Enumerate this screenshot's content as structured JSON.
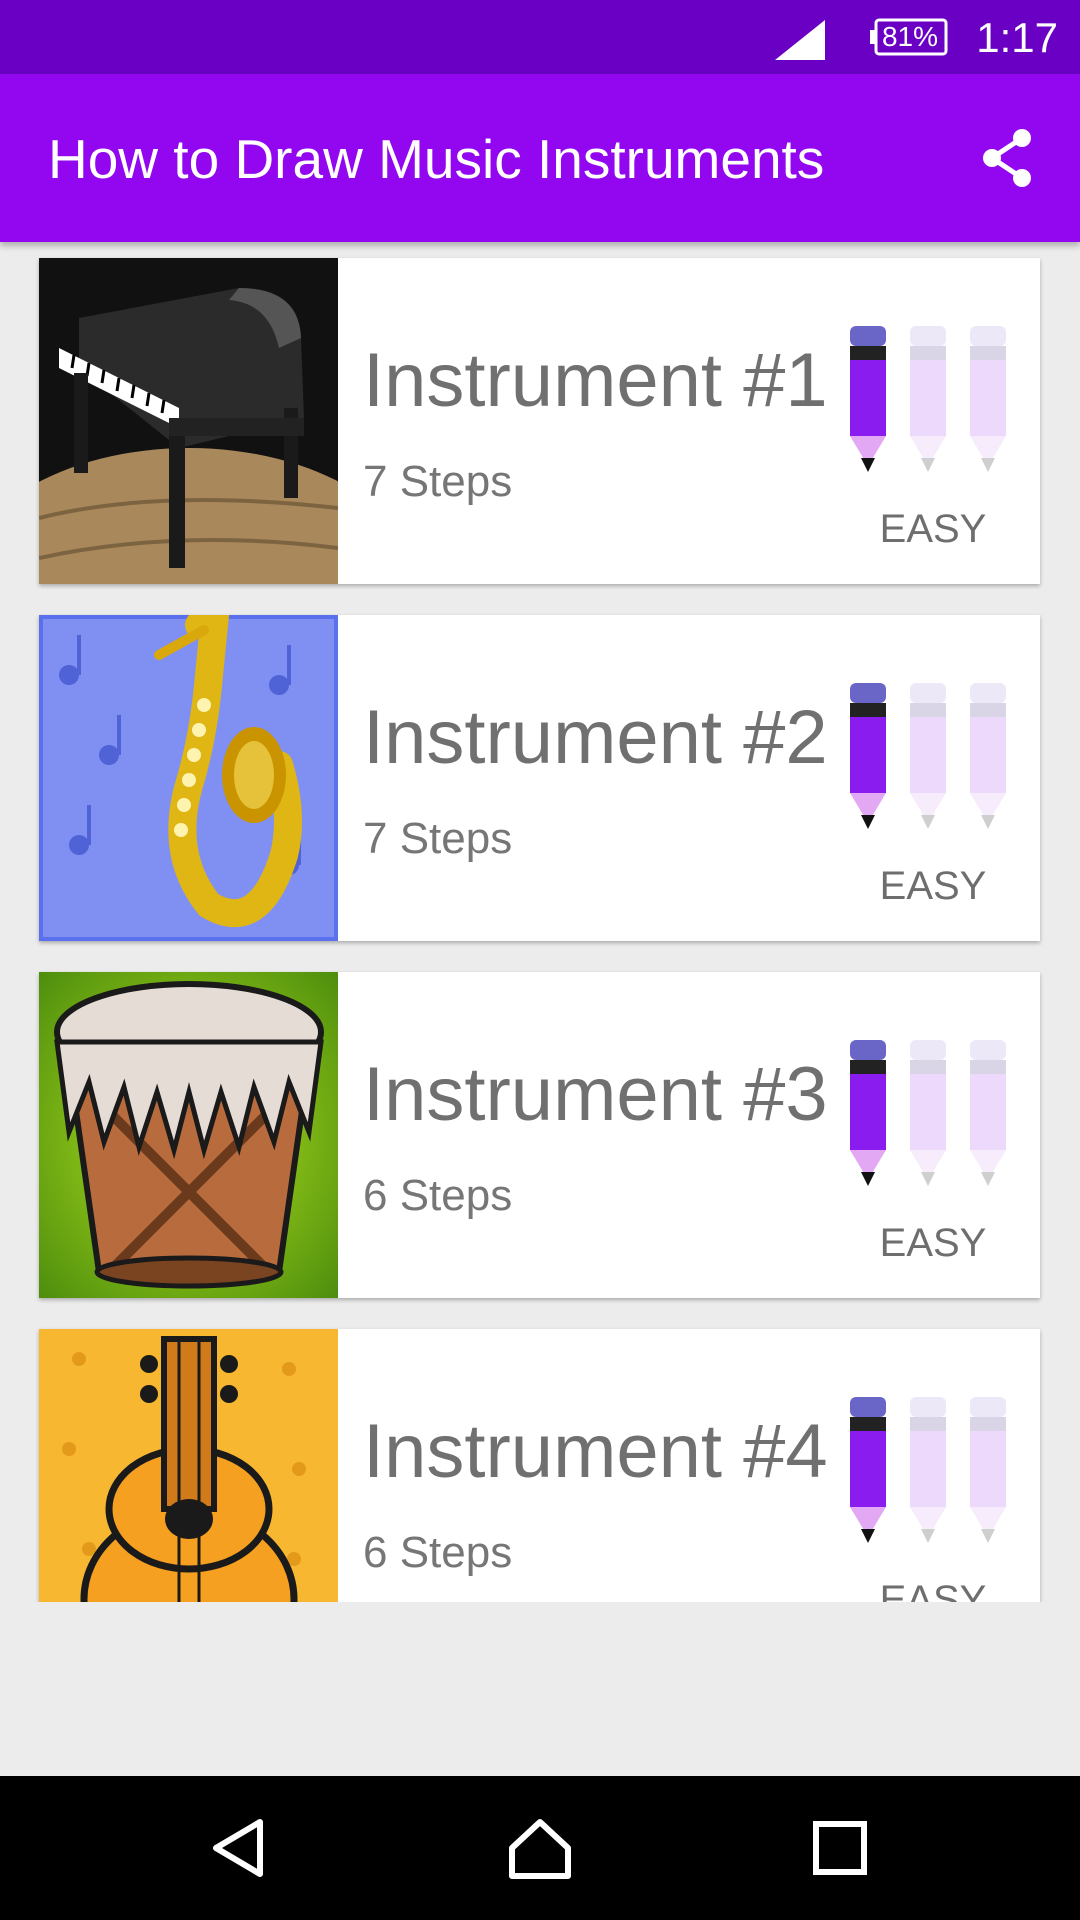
{
  "status_bar": {
    "battery": "81%",
    "time": "1:17",
    "icons": [
      "signal-icon",
      "battery-icon"
    ]
  },
  "app_bar": {
    "title": "How to Draw Music Instruments",
    "share_icon": "share-icon"
  },
  "instruments": [
    {
      "name": "Instrument #1",
      "steps": "7 Steps",
      "difficulty": "EASY",
      "difficulty_level": 1,
      "image": "grand-piano"
    },
    {
      "name": "Instrument #2",
      "steps": "7 Steps",
      "difficulty": "EASY",
      "difficulty_level": 1,
      "image": "saxophone"
    },
    {
      "name": "Instrument #3",
      "steps": "6 Steps",
      "difficulty": "EASY",
      "difficulty_level": 1,
      "image": "drum"
    },
    {
      "name": "Instrument #4",
      "steps": "6 Steps",
      "difficulty": "EASY",
      "difficulty_level": 1,
      "image": "guitar"
    }
  ],
  "nav_bar": {
    "icons": [
      "back-icon",
      "home-icon",
      "recents-icon"
    ]
  },
  "colors": {
    "status_bar": "#6a00c4",
    "app_bar": "#9206f0",
    "pencil_active": "#8a1cf0",
    "pencil_inactive": "#ecd9fb"
  }
}
